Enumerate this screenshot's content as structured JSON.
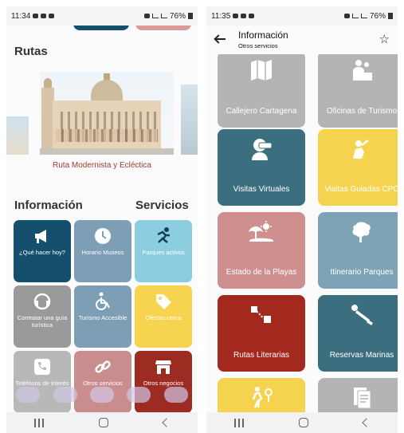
{
  "left_screen": {
    "status": {
      "time": "11:34",
      "battery": "76%"
    },
    "rutas_title": "Rutas",
    "route_caption": "Ruta Modernista y Ecléctica",
    "informacion_title": "Información",
    "servicios_title": "Servicios",
    "tiles": [
      {
        "label": "¿Qué hacer hoy?",
        "color": "#14506e",
        "icon": "megaphone-icon"
      },
      {
        "label": "Horario Museos",
        "color": "#7d9eb4",
        "icon": "clock-icon"
      },
      {
        "label": "Parques activos",
        "color": "#8dcde0",
        "icon": "running-person-icon"
      },
      {
        "label": "Contratar una guía turística",
        "color": "#9a9a9a",
        "icon": "headset-icon"
      },
      {
        "label": "Turismo Accesible",
        "color": "#7d9eb4",
        "icon": "wheelchair-icon"
      },
      {
        "label": "Ofertas cerca",
        "color": "#f7d44f",
        "icon": "tag-icon"
      },
      {
        "label": "Teléfonos de interés",
        "color": "#b8b8b8",
        "icon": "phone-icon"
      },
      {
        "label": "Otros servicios",
        "color": "#c98d8d",
        "icon": "link-icon"
      },
      {
        "label": "Otros negocios",
        "color": "#9c2b22",
        "icon": "store-icon"
      }
    ],
    "tile_labels_visible": [
      "¿Qué hacer hoy?",
      "Horario Museos",
      "Parques activos",
      "Contratar una guía turística",
      "Turismo Accesible",
      "Ofertas cerca",
      "Otros servicios",
      "Otros negocios"
    ]
  },
  "right_screen": {
    "status": {
      "time": "11:35",
      "battery": "76%"
    },
    "title": "Información",
    "subtitle": "Otros servicios",
    "tiles": [
      {
        "label": "Callejero Cartagena",
        "color": "#b4b4b4",
        "icon": "map-icon"
      },
      {
        "label": "Oficinas de Turismo",
        "color": "#b4b4b4",
        "icon": "info-desk-icon"
      },
      {
        "label": "Visitas Virtuales",
        "color": "#3b6e7e",
        "icon": "vr-headset-icon"
      },
      {
        "label": "Visitas Guiadas CPC",
        "color": "#f6d34f",
        "icon": "guide-icon"
      },
      {
        "label": "Estado de la Playas",
        "color": "#cf8f8f",
        "icon": "beach-icon"
      },
      {
        "label": "Itinerario Parques",
        "color": "#7ea2b6",
        "icon": "park-icon"
      },
      {
        "label": "Rutas Literarias",
        "color": "#a3281d",
        "icon": "route-icon"
      },
      {
        "label": "Reservas Marinas",
        "color": "#3b6e7e",
        "icon": "diver-icon"
      },
      {
        "label": "",
        "color": "#f6d34f",
        "icon": "hiker-icon"
      },
      {
        "label": "",
        "color": "#b4b4b4",
        "icon": "document-icon"
      }
    ]
  }
}
